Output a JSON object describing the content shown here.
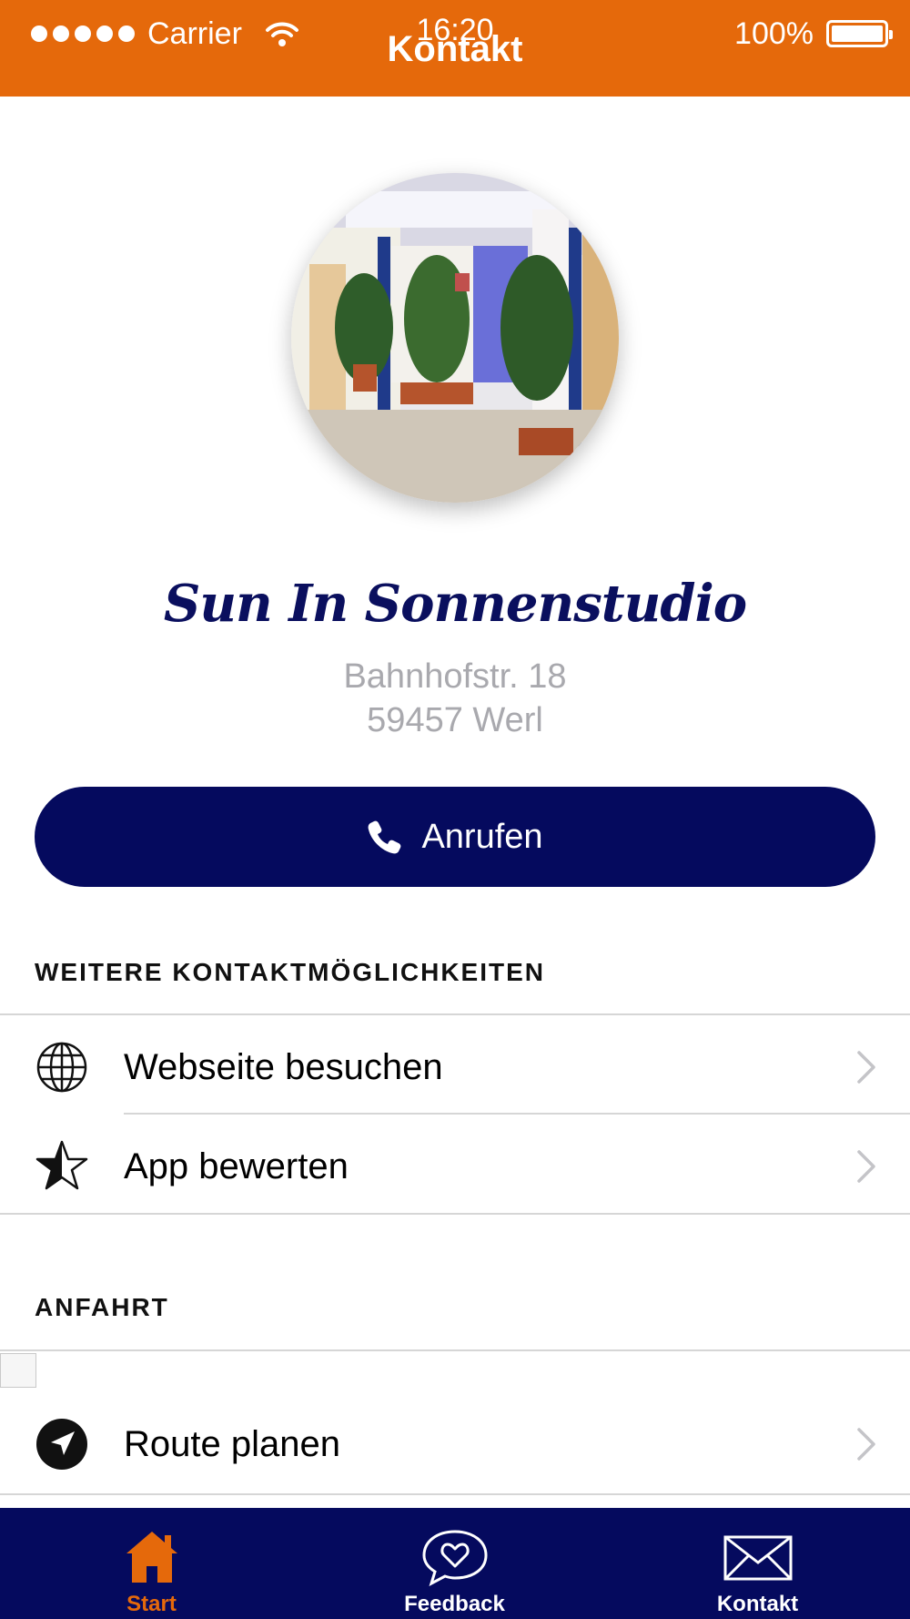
{
  "colors": {
    "accent": "#E5690B",
    "navy": "#050A5E",
    "address_gray": "#A9A9AE",
    "divider": "#D6D6D6"
  },
  "status_bar": {
    "carrier": "Carrier",
    "time": "16:20",
    "battery": "100%"
  },
  "header": {
    "title": "Kontakt"
  },
  "business": {
    "name": "Sun In Sonnenstudio",
    "address_line1": "Bahnhofstr. 18",
    "address_line2": "59457 Werl"
  },
  "call_button": {
    "label": "Anrufen",
    "icon": "phone-icon"
  },
  "sections": {
    "contact_options": {
      "title": "WEITERE KONTAKTMÖGLICHKEITEN",
      "items": [
        {
          "label": "Webseite besuchen",
          "icon": "globe-icon"
        },
        {
          "label": "App bewerten",
          "icon": "star-icon"
        }
      ]
    },
    "directions": {
      "title": "ANFAHRT",
      "items": [
        {
          "label": "Route planen",
          "icon": "navigation-arrow-icon"
        }
      ]
    }
  },
  "tabbar": {
    "tabs": [
      {
        "label": "Start",
        "icon": "home-icon",
        "active": true
      },
      {
        "label": "Feedback",
        "icon": "heart-speech-bubble-icon",
        "active": false
      },
      {
        "label": "Kontakt",
        "icon": "envelope-icon",
        "active": false
      }
    ]
  }
}
